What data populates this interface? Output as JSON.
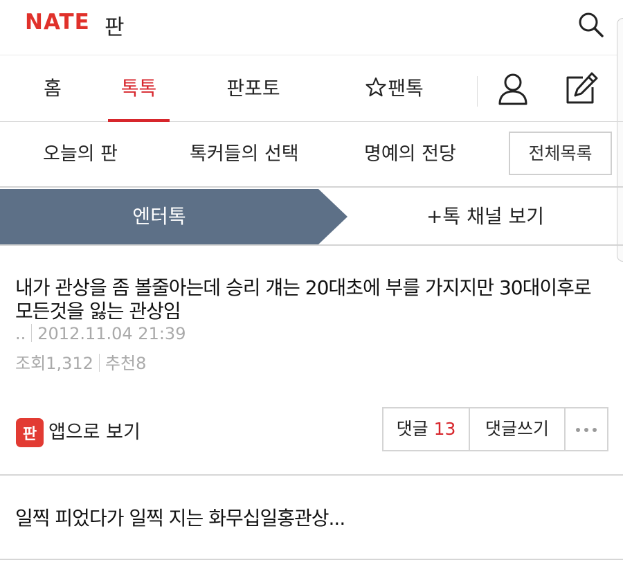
{
  "header": {
    "logo_text": "NATE",
    "logo_sub": "판",
    "brand_color": "#e0312b",
    "search_icon": "search-icon"
  },
  "nav": {
    "items": [
      {
        "label": "홈",
        "active": false
      },
      {
        "label": "톡톡",
        "active": true
      },
      {
        "label": "판포토",
        "active": false
      }
    ],
    "fantalk_label": "팬톡",
    "icons": [
      "star-icon",
      "user-icon",
      "write-icon"
    ],
    "active_color": "#d7262c"
  },
  "subnav": {
    "items": [
      "오늘의 판",
      "톡커들의 선택",
      "명예의 전당"
    ],
    "all_list_label": "전체목록"
  },
  "channel": {
    "name": "엔터톡",
    "more_label": "+톡 채널 보기",
    "color": "#5d7087"
  },
  "post": {
    "title": "내가 관상을 좀 볼줄아는데 승리 걔는 20대초에 부를 가지지만 30대이후로 모든것을 잃는 관상임",
    "author": "..",
    "date": "2012.11.04 21:39",
    "views_label": "조회",
    "views": "1,312",
    "recommend_label": "추천",
    "recommend": "8",
    "app_view_label": "앱으로 보기",
    "app_icon_char": "판",
    "comments_label": "댓글",
    "comments_count": "13",
    "write_comment_label": "댓글쓰기",
    "more_icon": "more-dots-icon"
  },
  "next_post": {
    "title": "일찍 피었다가 일찍 지는 화무십일홍관상..."
  }
}
